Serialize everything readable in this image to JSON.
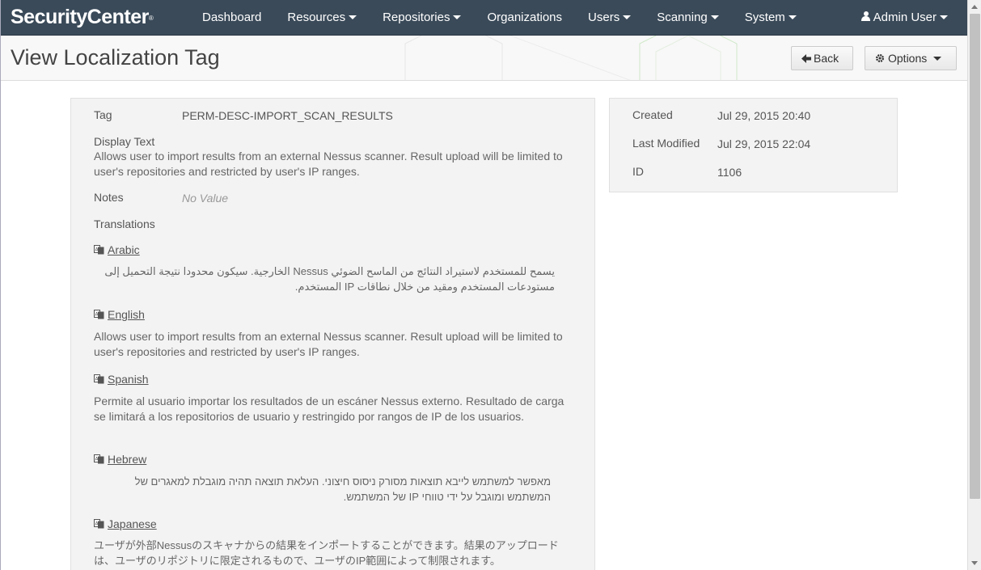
{
  "app": {
    "brand": "SecurityCenter",
    "brand_mark": "®"
  },
  "nav": {
    "items": [
      {
        "label": "Dashboard",
        "dropdown": false
      },
      {
        "label": "Resources",
        "dropdown": true
      },
      {
        "label": "Repositories",
        "dropdown": true
      },
      {
        "label": "Organizations",
        "dropdown": false
      },
      {
        "label": "Users",
        "dropdown": true
      },
      {
        "label": "Scanning",
        "dropdown": true
      },
      {
        "label": "System",
        "dropdown": true
      }
    ],
    "user": {
      "label": "Admin User",
      "icon": "user-icon"
    }
  },
  "header": {
    "title": "View Localization Tag",
    "back_label": "Back",
    "options_label": "Options"
  },
  "details": {
    "tag_label": "Tag",
    "tag_value": "PERM-DESC-IMPORT_SCAN_RESULTS",
    "display_text_label": "Display Text",
    "display_text_value": "Allows user to import results from an external Nessus scanner. Result upload will be limited to user's repositories and restricted by user's IP ranges.",
    "notes_label": "Notes",
    "notes_value": "No Value",
    "translations_label": "Translations",
    "translations": [
      {
        "language": "Arabic",
        "text": "يسمح للمستخدم لاستيراد النتائج من الماسح الضوئي Nessus الخارجية. سيكون محدودا نتيجة التحميل إلى مستودعات المستخدم ومقيد من خلال نطاقات IP المستخدم."
      },
      {
        "language": "English",
        "text": "Allows user to import results from an external Nessus scanner. Result upload will be limited to user's repositories and restricted by user's IP ranges."
      },
      {
        "language": "Spanish",
        "text": "Permite al usuario importar los resultados de un escáner Nessus externo. Resultado de carga se limitará a los repositorios de usuario y restringido por rangos de IP de los usuarios."
      },
      {
        "language": "Hebrew",
        "text": "מאפשר למשתמש לייבא תוצאות מסורק ניסוס חיצוני. העלאת תוצאה תהיה מוגבלת למאגרים של המשתמש ומוגבל על ידי טווחי IP של המשתמש."
      },
      {
        "language": "Japanese",
        "text": "ユーザが外部Nessusのスキャナからの結果をインポートすることができます。結果のアップロードは、ユーザのリポジトリに限定されるもので、ユーザのIP範囲によって制限されます。"
      }
    ]
  },
  "meta": {
    "created_label": "Created",
    "created_value": "Jul 29, 2015 20:40",
    "modified_label": "Last Modified",
    "modified_value": "Jul 29, 2015 22:04",
    "id_label": "ID",
    "id_value": "1106"
  }
}
